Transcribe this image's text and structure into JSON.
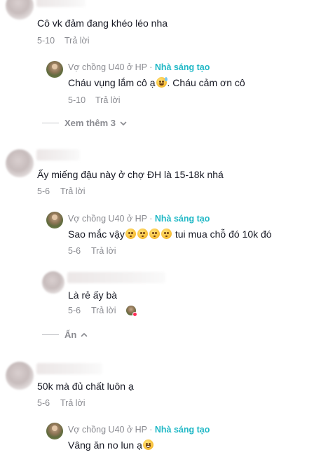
{
  "comments": [
    {
      "text": "Cô vk đảm đang khéo léo nha",
      "date": "5-10",
      "reply_label": "Trả lời"
    },
    {
      "text": "Ấy miếng đậu này ở chợ ĐH là 15-18k nhá",
      "date": "5-6",
      "reply_label": "Trả lời"
    },
    {
      "text": "50k mà đủ chất luôn ạ",
      "date": "5-6",
      "reply_label": "Trả lời"
    }
  ],
  "creator": {
    "name": "Vợ chồng U40 ở HP",
    "separator": " · ",
    "badge": "Nhà sáng tạo"
  },
  "replies": [
    {
      "text_before": "Cháu vụng lắm cô ạ",
      "emoji": "sweat-smile-emoji",
      "text_after": ". Cháu cảm ơn cô",
      "date": "5-10",
      "reply_label": "Trả lời"
    },
    {
      "text_before": "Sao mắc vậy",
      "emojis": [
        "flushed-emoji",
        "flushed-emoji",
        "flushed-emoji",
        "flushed-emoji"
      ],
      "text_after": " tui mua chỗ đó 10k đó",
      "date": "5-6",
      "reply_label": "Trả lời"
    },
    {
      "text": "Là rẻ ấy bà",
      "date": "5-6",
      "reply_label": "Trả lời"
    },
    {
      "text_before": "Vâng ăn no lun ạ",
      "emoji": "grin-emoji",
      "date": "",
      "reply_label": ""
    }
  ],
  "toggles": {
    "view_more": "Xem thêm 3",
    "hide": "Ẩn"
  },
  "colors": {
    "text": "#161823",
    "muted": "#8a8b91",
    "creator_badge": "#20b8c6",
    "like_dot": "#fe2c55"
  }
}
